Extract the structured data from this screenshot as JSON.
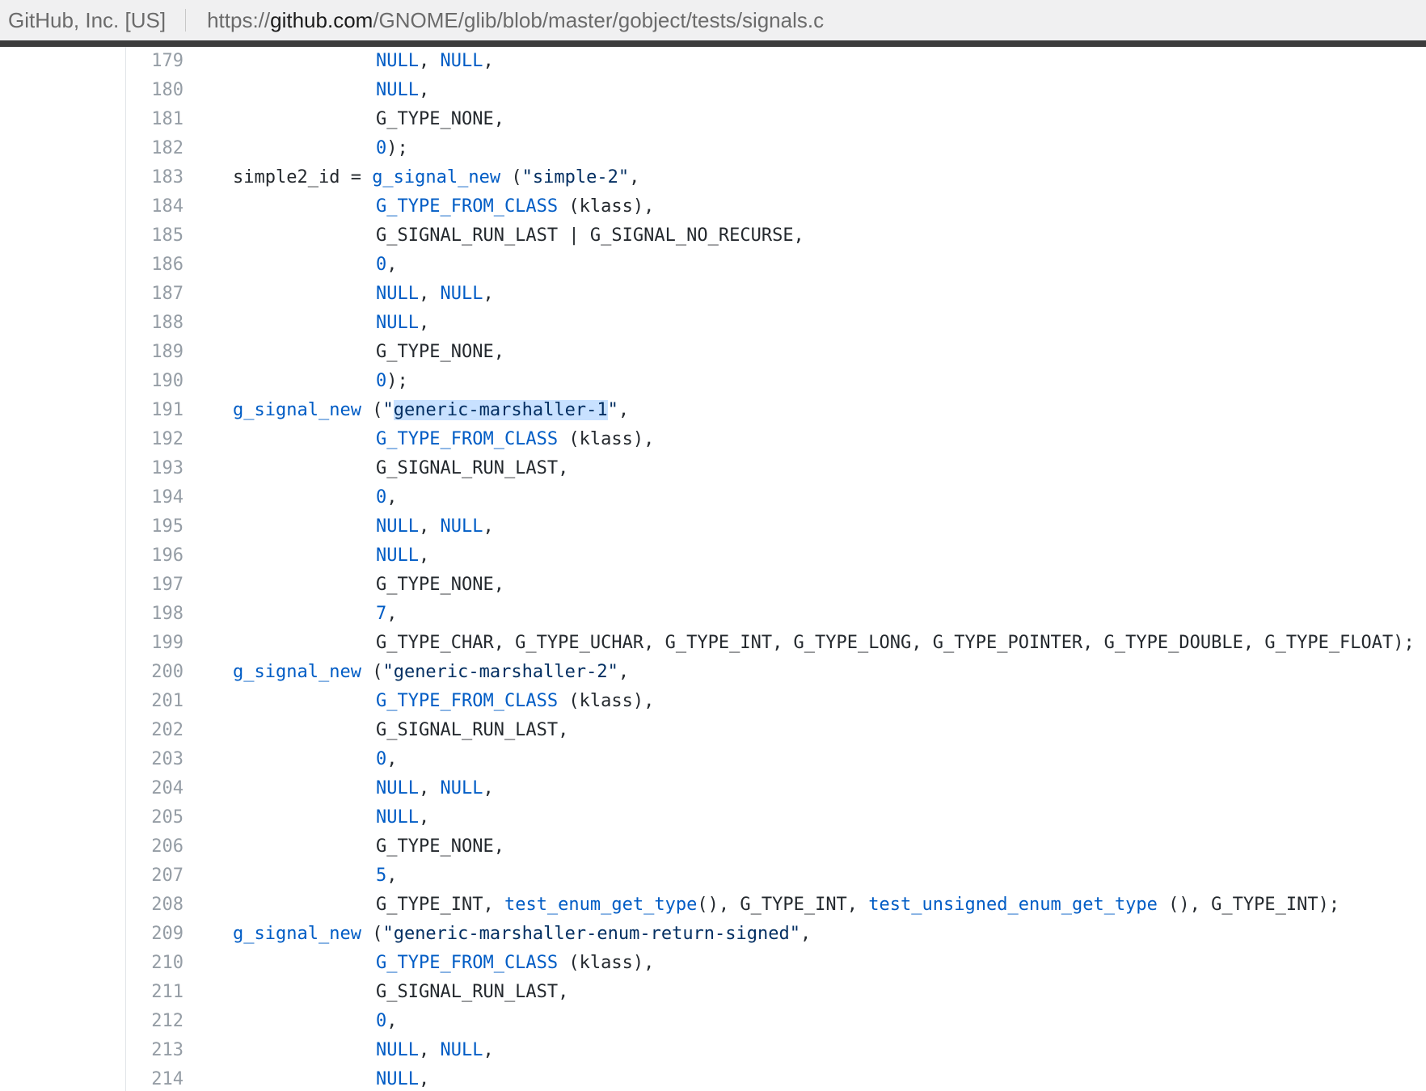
{
  "browser": {
    "site_identity": "GitHub, Inc. [US]",
    "url_scheme": "https://",
    "url_host": "github.com",
    "url_path": "/GNOME/glib/blob/master/gobject/tests/signals.c"
  },
  "code": {
    "lines": [
      {
        "number": "179",
        "indent": 1,
        "tokens": [
          [
            "k",
            "NULL"
          ],
          [
            "p",
            ", "
          ],
          [
            "k",
            "NULL"
          ],
          [
            "p",
            ","
          ]
        ]
      },
      {
        "number": "180",
        "indent": 1,
        "tokens": [
          [
            "k",
            "NULL"
          ],
          [
            "p",
            ","
          ]
        ]
      },
      {
        "number": "181",
        "indent": 1,
        "tokens": [
          [
            "p",
            "G_TYPE_NONE,"
          ]
        ]
      },
      {
        "number": "182",
        "indent": 1,
        "tokens": [
          [
            "k",
            "0"
          ],
          [
            "p",
            ");"
          ]
        ]
      },
      {
        "number": "183",
        "indent": 0,
        "tokens": [
          [
            "p",
            "simple2_id = "
          ],
          [
            "k",
            "g_signal_new"
          ],
          [
            "p",
            " ("
          ],
          [
            "s",
            "\"simple-2\""
          ],
          [
            "p",
            ","
          ]
        ]
      },
      {
        "number": "184",
        "indent": 1,
        "tokens": [
          [
            "k",
            "G_TYPE_FROM_CLASS"
          ],
          [
            "p",
            " (klass),"
          ]
        ]
      },
      {
        "number": "185",
        "indent": 1,
        "tokens": [
          [
            "p",
            "G_SIGNAL_RUN_LAST | G_SIGNAL_NO_RECURSE,"
          ]
        ]
      },
      {
        "number": "186",
        "indent": 1,
        "tokens": [
          [
            "k",
            "0"
          ],
          [
            "p",
            ","
          ]
        ]
      },
      {
        "number": "187",
        "indent": 1,
        "tokens": [
          [
            "k",
            "NULL"
          ],
          [
            "p",
            ", "
          ],
          [
            "k",
            "NULL"
          ],
          [
            "p",
            ","
          ]
        ]
      },
      {
        "number": "188",
        "indent": 1,
        "tokens": [
          [
            "k",
            "NULL"
          ],
          [
            "p",
            ","
          ]
        ]
      },
      {
        "number": "189",
        "indent": 1,
        "tokens": [
          [
            "p",
            "G_TYPE_NONE,"
          ]
        ]
      },
      {
        "number": "190",
        "indent": 1,
        "tokens": [
          [
            "k",
            "0"
          ],
          [
            "p",
            ");"
          ]
        ]
      },
      {
        "number": "191",
        "indent": 0,
        "tokens": [
          [
            "k",
            "g_signal_new"
          ],
          [
            "p",
            " ("
          ],
          [
            "s",
            "\""
          ],
          [
            "h",
            "generic-marshaller-1"
          ],
          [
            "s",
            "\""
          ],
          [
            "p",
            ","
          ]
        ]
      },
      {
        "number": "192",
        "indent": 1,
        "tokens": [
          [
            "k",
            "G_TYPE_FROM_CLASS"
          ],
          [
            "p",
            " (klass),"
          ]
        ]
      },
      {
        "number": "193",
        "indent": 1,
        "tokens": [
          [
            "p",
            "G_SIGNAL_RUN_LAST,"
          ]
        ]
      },
      {
        "number": "194",
        "indent": 1,
        "tokens": [
          [
            "k",
            "0"
          ],
          [
            "p",
            ","
          ]
        ]
      },
      {
        "number": "195",
        "indent": 1,
        "tokens": [
          [
            "k",
            "NULL"
          ],
          [
            "p",
            ", "
          ],
          [
            "k",
            "NULL"
          ],
          [
            "p",
            ","
          ]
        ]
      },
      {
        "number": "196",
        "indent": 1,
        "tokens": [
          [
            "k",
            "NULL"
          ],
          [
            "p",
            ","
          ]
        ]
      },
      {
        "number": "197",
        "indent": 1,
        "tokens": [
          [
            "p",
            "G_TYPE_NONE,"
          ]
        ]
      },
      {
        "number": "198",
        "indent": 1,
        "tokens": [
          [
            "k",
            "7"
          ],
          [
            "p",
            ","
          ]
        ]
      },
      {
        "number": "199",
        "indent": 1,
        "tokens": [
          [
            "p",
            "G_TYPE_CHAR, G_TYPE_UCHAR, G_TYPE_INT, G_TYPE_LONG, G_TYPE_POINTER, G_TYPE_DOUBLE, G_TYPE_FLOAT);"
          ]
        ]
      },
      {
        "number": "200",
        "indent": 0,
        "tokens": [
          [
            "k",
            "g_signal_new"
          ],
          [
            "p",
            " ("
          ],
          [
            "s",
            "\"generic-marshaller-2\""
          ],
          [
            "p",
            ","
          ]
        ]
      },
      {
        "number": "201",
        "indent": 1,
        "tokens": [
          [
            "k",
            "G_TYPE_FROM_CLASS"
          ],
          [
            "p",
            " (klass),"
          ]
        ]
      },
      {
        "number": "202",
        "indent": 1,
        "tokens": [
          [
            "p",
            "G_SIGNAL_RUN_LAST,"
          ]
        ]
      },
      {
        "number": "203",
        "indent": 1,
        "tokens": [
          [
            "k",
            "0"
          ],
          [
            "p",
            ","
          ]
        ]
      },
      {
        "number": "204",
        "indent": 1,
        "tokens": [
          [
            "k",
            "NULL"
          ],
          [
            "p",
            ", "
          ],
          [
            "k",
            "NULL"
          ],
          [
            "p",
            ","
          ]
        ]
      },
      {
        "number": "205",
        "indent": 1,
        "tokens": [
          [
            "k",
            "NULL"
          ],
          [
            "p",
            ","
          ]
        ]
      },
      {
        "number": "206",
        "indent": 1,
        "tokens": [
          [
            "p",
            "G_TYPE_NONE,"
          ]
        ]
      },
      {
        "number": "207",
        "indent": 1,
        "tokens": [
          [
            "k",
            "5"
          ],
          [
            "p",
            ","
          ]
        ]
      },
      {
        "number": "208",
        "indent": 1,
        "tokens": [
          [
            "p",
            "G_TYPE_INT, "
          ],
          [
            "k",
            "test_enum_get_type"
          ],
          [
            "p",
            "(), G_TYPE_INT, "
          ],
          [
            "k",
            "test_unsigned_enum_get_type"
          ],
          [
            "p",
            " (), G_TYPE_INT);"
          ]
        ]
      },
      {
        "number": "209",
        "indent": 0,
        "tokens": [
          [
            "k",
            "g_signal_new"
          ],
          [
            "p",
            " ("
          ],
          [
            "s",
            "\"generic-marshaller-enum-return-signed\""
          ],
          [
            "p",
            ","
          ]
        ]
      },
      {
        "number": "210",
        "indent": 1,
        "tokens": [
          [
            "k",
            "G_TYPE_FROM_CLASS"
          ],
          [
            "p",
            " (klass),"
          ]
        ]
      },
      {
        "number": "211",
        "indent": 1,
        "tokens": [
          [
            "p",
            "G_SIGNAL_RUN_LAST,"
          ]
        ]
      },
      {
        "number": "212",
        "indent": 1,
        "tokens": [
          [
            "k",
            "0"
          ],
          [
            "p",
            ","
          ]
        ]
      },
      {
        "number": "213",
        "indent": 1,
        "tokens": [
          [
            "k",
            "NULL"
          ],
          [
            "p",
            ", "
          ],
          [
            "k",
            "NULL"
          ],
          [
            "p",
            ","
          ]
        ]
      },
      {
        "number": "214",
        "indent": 1,
        "tokens": [
          [
            "k",
            "NULL"
          ],
          [
            "p",
            ","
          ]
        ]
      }
    ]
  }
}
